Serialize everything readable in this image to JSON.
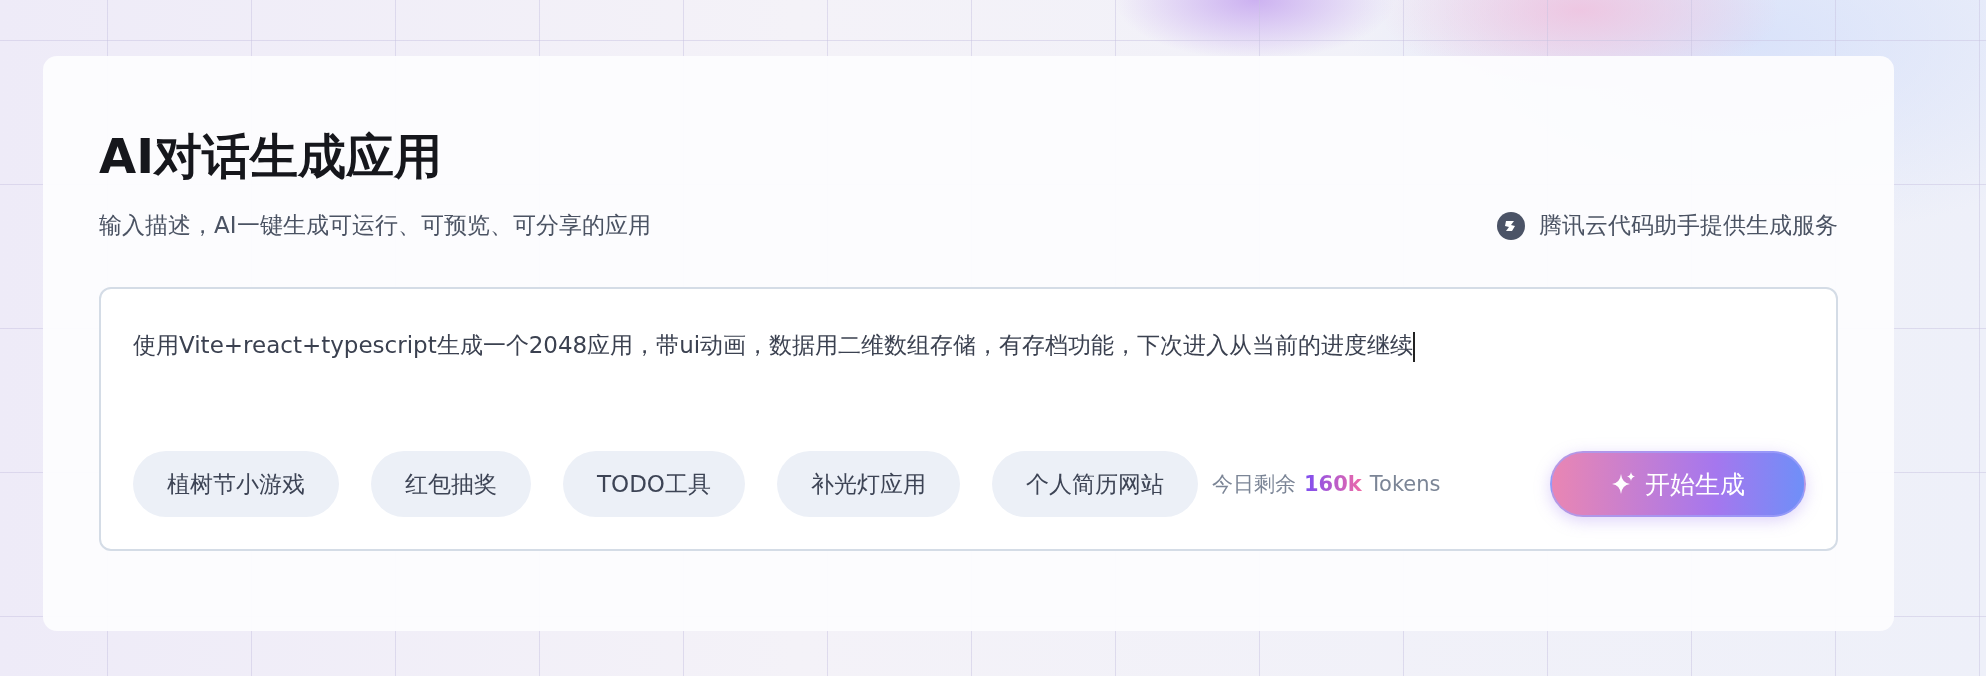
{
  "title": "AI对话生成应用",
  "subtitle": "输入描述，AI一键生成可运行、可预览、可分享的应用",
  "provider": {
    "label": "腾讯云代码助手提供生成服务"
  },
  "prompt": {
    "value": "使用Vite+react+typescript生成一个2048应用，带ui动画，数据用二维数组存储，有存档功能，下次进入从当前的进度继续"
  },
  "suggestions": [
    {
      "label": "植树节小游戏"
    },
    {
      "label": "红包抽奖"
    },
    {
      "label": "TODO工具"
    },
    {
      "label": "补光灯应用"
    },
    {
      "label": "个人简历网站"
    }
  ],
  "quota": {
    "label": "今日剩余",
    "amount": "160k",
    "unit": "Tokens"
  },
  "generate_button": {
    "label": "开始生成"
  }
}
